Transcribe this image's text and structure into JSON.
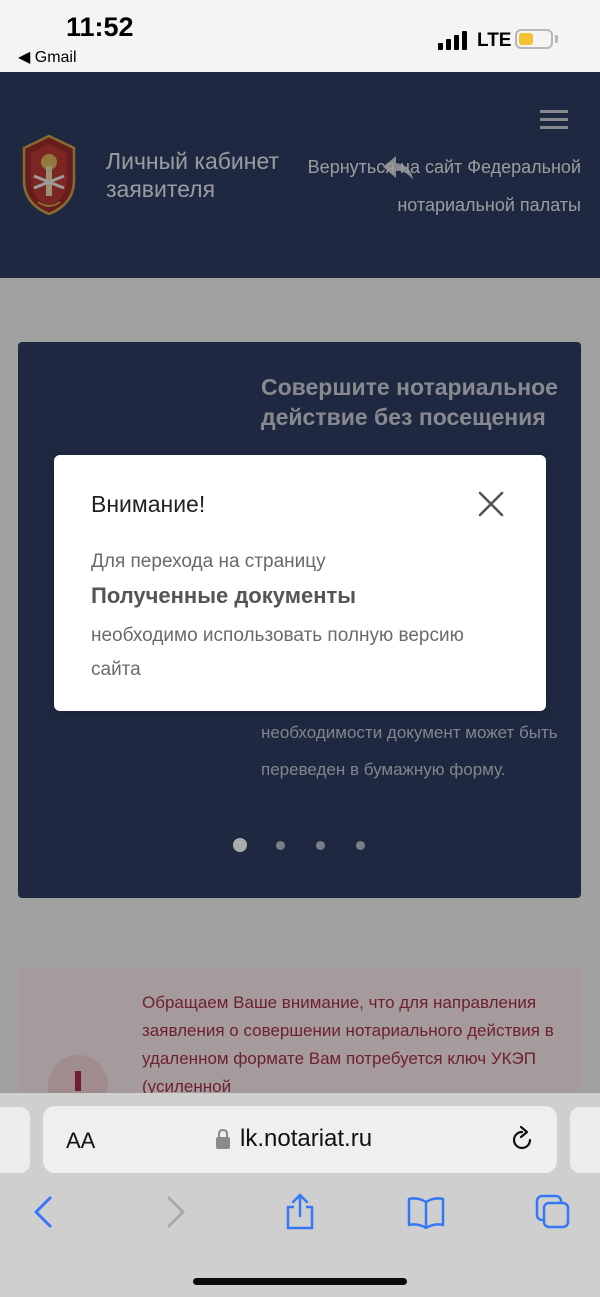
{
  "status_bar": {
    "time": "11:52",
    "back_label": "◀ Gmail",
    "network": "LTE"
  },
  "header": {
    "site_title": "Личный кабинет заявителя",
    "return_link": "Вернуться на сайт Федеральной нотариальной палаты"
  },
  "carousel": {
    "heading": "Совершите нотариальное действие без посещения",
    "text": "необходимости документ может быть переведен в бумажную форму.",
    "slide_count": 4,
    "active_slide": 1
  },
  "notice": {
    "text": "Обращаем Ваше внимание, что для направления заявления о совершении нотариального действия в удаленном формате Вам потребуется ключ УКЭП (усиленной"
  },
  "modal": {
    "title": "Внимание!",
    "line1": "Для перехода на страницу",
    "link": "Полученные документы",
    "line2": "необходимо использовать полную версию сайта"
  },
  "browser": {
    "aa_label": "AA",
    "url": "lk.notariat.ru"
  },
  "colors": {
    "header_bg": "#2d3e62",
    "notice_text": "#a43148",
    "toolbar_icons": "#3478f6"
  }
}
